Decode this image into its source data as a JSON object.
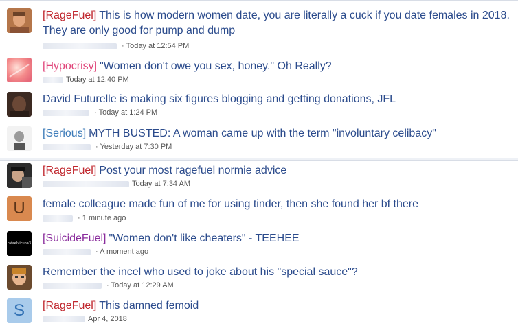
{
  "threads": [
    {
      "prefix": "[RageFuel]",
      "title": "This is how modern women date, you are literally a cuck if you date females in 2018. They are only good for pump and dump",
      "time": "Today at 12:54 PM",
      "separator": " · "
    },
    {
      "prefix": "[Hypocrisy]",
      "title": "\"Women don't owe you sex, honey.\" Oh Really?",
      "time": "Today at 12:40 PM",
      "separator": ""
    },
    {
      "prefix": "",
      "title": "David Futurelle is making six figures blogging and getting donations, JFL",
      "time": "Today at 1:24 PM",
      "separator": " · "
    },
    {
      "prefix": "[Serious]",
      "title": "MYTH BUSTED: A woman came up with the term \"involuntary celibacy\"",
      "time": "Yesterday at 7:30 PM",
      "separator": " · "
    },
    {
      "prefix": "[RageFuel]",
      "title": "Post your most ragefuel normie advice",
      "time": "Today at 7:34 AM",
      "separator": ""
    },
    {
      "prefix": "",
      "title": "female colleague made fun of me for using tinder, then she found her bf there",
      "time": "1 minute ago",
      "separator": " · ",
      "avatar_letter": "U"
    },
    {
      "prefix": "[SuicideFuel]",
      "title": "\"Women don't like cheaters\" - TEEHEE",
      "time": "A moment ago",
      "separator": " · ",
      "avatar_text": "rafaelvicuna3"
    },
    {
      "prefix": "",
      "title": "Remember the incel who used to joke about his \"special sauce\"?",
      "time": "Today at 12:29 AM",
      "separator": " · "
    },
    {
      "prefix": "[RageFuel]",
      "title": "This damned femoid",
      "time": "Apr 4, 2018",
      "separator": "",
      "avatar_letter": "S"
    }
  ],
  "colors": {
    "title": "#2b4b8c",
    "ragefuel": "#c0262d",
    "hypocrisy": "#e0457a",
    "serious": "#3b7ab8",
    "suicidefuel": "#8a2c9c",
    "avatar_u": "#d9894f",
    "avatar_s": "#4a90d9"
  },
  "icons": {
    "avatar_1": "user-photo-icon",
    "avatar_2": "pink-light-icon",
    "avatar_3": "user-photo-icon",
    "avatar_4": "grayscale-photo-icon",
    "avatar_5": "user-photo-icon",
    "avatar_8": "user-photo-icon"
  }
}
